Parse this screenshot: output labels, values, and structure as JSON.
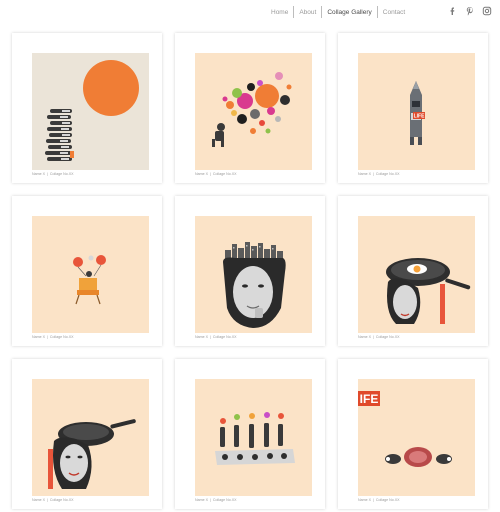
{
  "nav": {
    "items": [
      {
        "label": "Home",
        "active": false
      },
      {
        "label": "About",
        "active": false
      },
      {
        "label": "Collage Gallery",
        "active": true
      },
      {
        "label": "Contact",
        "active": false
      }
    ],
    "social_icons": [
      "facebook-icon",
      "pinterest-icon",
      "instagram-icon"
    ]
  },
  "gallery": {
    "cards": [
      {
        "art": "falling-figures-orange-sun",
        "bg": "#ebe4d8",
        "caption": {
          "artist": "Name X",
          "title": "Collage No.XX"
        }
      },
      {
        "art": "confetti-circles-thinker",
        "bg": "#fbe3c7",
        "caption": {
          "artist": "Name X",
          "title": "Collage No.XX"
        }
      },
      {
        "art": "rocket-life",
        "bg": "#fbe3c7",
        "caption": {
          "artist": "Name X",
          "title": "Collage No.XX"
        }
      },
      {
        "art": "orange-chair",
        "bg": "#fbe3c7",
        "caption": {
          "artist": "Name X",
          "title": "Collage No.XX"
        }
      },
      {
        "art": "city-head",
        "bg": "#fbe3c7",
        "caption": {
          "artist": "Name X",
          "title": "Collage No.XX"
        }
      },
      {
        "art": "frying-pan-egg",
        "bg": "#fbe3c7",
        "caption": {
          "artist": "Name X",
          "title": "Collage No.XX"
        }
      },
      {
        "art": "frying-pan-woman",
        "bg": "#fbe3c7",
        "caption": {
          "artist": "Name X",
          "title": "Collage No.XX"
        }
      },
      {
        "art": "lined-figures-balloons",
        "bg": "#fbe3c7",
        "caption": {
          "artist": "Name X",
          "title": "Collage No.XX"
        }
      },
      {
        "art": "life-meat",
        "bg": "#fbe3c7",
        "caption": {
          "artist": "Name X",
          "title": "Collage No.XX"
        }
      }
    ]
  },
  "art_text": {
    "rocket_label": "LIFE",
    "life_label": "IFE"
  },
  "colors": {
    "accent_orange": "#f07d35",
    "paper": "#fbe3c7",
    "paper_grey": "#ebe4d8",
    "ink": "#2e2e2e"
  }
}
